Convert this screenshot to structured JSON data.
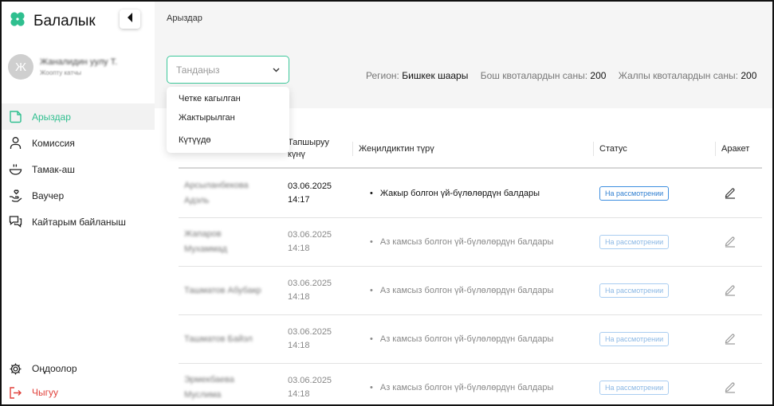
{
  "app": {
    "title": "Балалык"
  },
  "user": {
    "avatar_letter": "Ж",
    "name": "Жаналидин уулу Т.",
    "role": "Жоопту катчы"
  },
  "sidebar": {
    "items": [
      {
        "label": "Арыздар",
        "icon": "document-icon",
        "active": true
      },
      {
        "label": "Комиссия",
        "icon": "person-icon"
      },
      {
        "label": "Тамак-аш",
        "icon": "food-bowl-icon"
      },
      {
        "label": "Ваучер",
        "icon": "hand-heart-icon"
      },
      {
        "label": "Кайтарым байланыш",
        "icon": "chat-icon"
      }
    ],
    "bottom": [
      {
        "label": "Оңдоолор",
        "icon": "gear-icon"
      },
      {
        "label": "Чыгуу",
        "icon": "logout-icon"
      }
    ]
  },
  "breadcrumb": "Арыздар",
  "filter": {
    "placeholder": "Тандаңыз",
    "options": [
      "Четке кагылган",
      "Жактырылган",
      "Күтүүдө"
    ]
  },
  "stats": {
    "region_label": "Регион:",
    "region_value": "Бишкек шаары",
    "free_label": "Бош квоталардын саны:",
    "free_value": "200",
    "total_label": "Жалпы квоталардын саны:",
    "total_value": "200"
  },
  "table": {
    "columns": [
      "Тапшыруу күнү",
      "Жеңилдиктин түрү",
      "Статус",
      "Аракет"
    ],
    "rows": [
      {
        "name1": "Арсыланбекова",
        "name2": "Адэль",
        "date": "03.06.2025",
        "time": "14:17",
        "benefit": "Жакыр болгон үй-бүлөлөрдүн балдары",
        "status": "На рассмотрении"
      },
      {
        "name1": "Жапаров",
        "name2": "Мухаммад",
        "date": "03.06.2025",
        "time": "14:18",
        "benefit": "Аз камсыз болгон үй-бүлөлөрдүн балдары",
        "status": "На рассмотрении"
      },
      {
        "name1": "Ташматов Абубакр",
        "name2": "",
        "date": "03.06.2025",
        "time": "14:18",
        "benefit": "Аз камсыз болгон үй-бүлөлөрдүн балдары",
        "status": "На рассмотрении"
      },
      {
        "name1": "Ташматов Байэл",
        "name2": "",
        "date": "03.06.2025",
        "time": "14:18",
        "benefit": "Аз камсыз болгон үй-бүлөлөрдүн балдары",
        "status": "На рассмотрении"
      },
      {
        "name1": "Эрмекбаева",
        "name2": "Муслима",
        "date": "03.06.2025",
        "time": "14:18",
        "benefit": "Аз камсыз болгон үй-бүлөлөрдүн балдары",
        "status": "На рассмотрении"
      }
    ]
  },
  "colors": {
    "accent": "#2fbf8f",
    "danger": "#e0413b",
    "badge": "#2f7fd1"
  }
}
